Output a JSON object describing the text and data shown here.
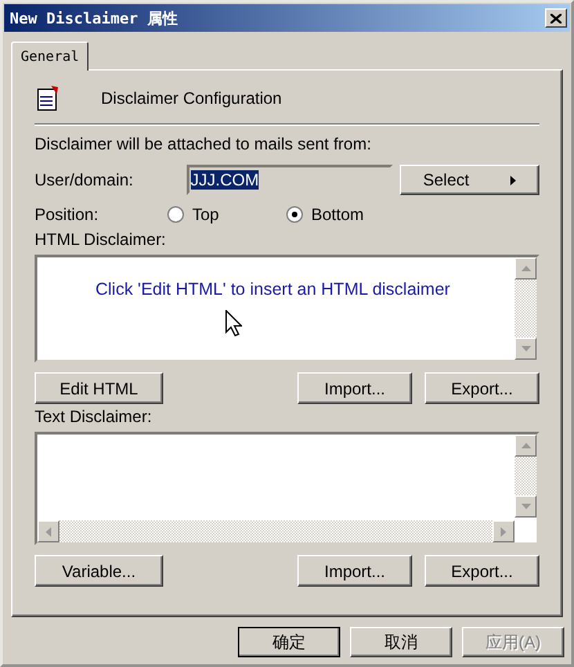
{
  "window": {
    "title": "New Disclaimer 属性"
  },
  "tabs": [
    {
      "label": "General",
      "selected": true
    }
  ],
  "header": {
    "title": "Disclaimer Configuration"
  },
  "attach_label": "Disclaimer will be attached to mails sent from:",
  "user_domain": {
    "label": "User/domain:",
    "value": "JJJ.COM",
    "value_selected": true,
    "button": "Select"
  },
  "position": {
    "label": "Position:",
    "options": [
      {
        "label": "Top",
        "selected": false
      },
      {
        "label": "Bottom",
        "selected": true
      }
    ]
  },
  "html_disclaimer": {
    "label": "HTML Disclaimer:",
    "hint": "Click 'Edit HTML' to insert an HTML disclaimer",
    "buttons": [
      "Edit HTML",
      "Import...",
      "Export..."
    ]
  },
  "text_disclaimer": {
    "label": "Text Disclaimer:",
    "buttons": [
      "Variable...",
      "Import...",
      "Export..."
    ]
  },
  "dialog_buttons": [
    {
      "label": "确定",
      "disabled": false,
      "default": true
    },
    {
      "label": "取消",
      "disabled": false,
      "default": false
    },
    {
      "label": "应用(A)",
      "disabled": true,
      "default": false
    }
  ]
}
